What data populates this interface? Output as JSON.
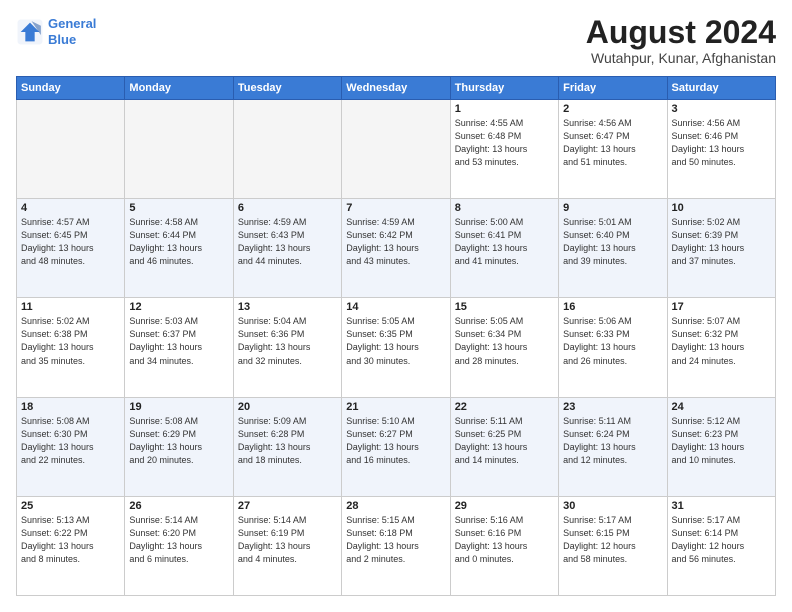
{
  "header": {
    "logo_line1": "General",
    "logo_line2": "Blue",
    "month_year": "August 2024",
    "location": "Wutahpur, Kunar, Afghanistan"
  },
  "weekdays": [
    "Sunday",
    "Monday",
    "Tuesday",
    "Wednesday",
    "Thursday",
    "Friday",
    "Saturday"
  ],
  "weeks": [
    [
      {
        "day": "",
        "info": ""
      },
      {
        "day": "",
        "info": ""
      },
      {
        "day": "",
        "info": ""
      },
      {
        "day": "",
        "info": ""
      },
      {
        "day": "1",
        "info": "Sunrise: 4:55 AM\nSunset: 6:48 PM\nDaylight: 13 hours\nand 53 minutes."
      },
      {
        "day": "2",
        "info": "Sunrise: 4:56 AM\nSunset: 6:47 PM\nDaylight: 13 hours\nand 51 minutes."
      },
      {
        "day": "3",
        "info": "Sunrise: 4:56 AM\nSunset: 6:46 PM\nDaylight: 13 hours\nand 50 minutes."
      }
    ],
    [
      {
        "day": "4",
        "info": "Sunrise: 4:57 AM\nSunset: 6:45 PM\nDaylight: 13 hours\nand 48 minutes."
      },
      {
        "day": "5",
        "info": "Sunrise: 4:58 AM\nSunset: 6:44 PM\nDaylight: 13 hours\nand 46 minutes."
      },
      {
        "day": "6",
        "info": "Sunrise: 4:59 AM\nSunset: 6:43 PM\nDaylight: 13 hours\nand 44 minutes."
      },
      {
        "day": "7",
        "info": "Sunrise: 4:59 AM\nSunset: 6:42 PM\nDaylight: 13 hours\nand 43 minutes."
      },
      {
        "day": "8",
        "info": "Sunrise: 5:00 AM\nSunset: 6:41 PM\nDaylight: 13 hours\nand 41 minutes."
      },
      {
        "day": "9",
        "info": "Sunrise: 5:01 AM\nSunset: 6:40 PM\nDaylight: 13 hours\nand 39 minutes."
      },
      {
        "day": "10",
        "info": "Sunrise: 5:02 AM\nSunset: 6:39 PM\nDaylight: 13 hours\nand 37 minutes."
      }
    ],
    [
      {
        "day": "11",
        "info": "Sunrise: 5:02 AM\nSunset: 6:38 PM\nDaylight: 13 hours\nand 35 minutes."
      },
      {
        "day": "12",
        "info": "Sunrise: 5:03 AM\nSunset: 6:37 PM\nDaylight: 13 hours\nand 34 minutes."
      },
      {
        "day": "13",
        "info": "Sunrise: 5:04 AM\nSunset: 6:36 PM\nDaylight: 13 hours\nand 32 minutes."
      },
      {
        "day": "14",
        "info": "Sunrise: 5:05 AM\nSunset: 6:35 PM\nDaylight: 13 hours\nand 30 minutes."
      },
      {
        "day": "15",
        "info": "Sunrise: 5:05 AM\nSunset: 6:34 PM\nDaylight: 13 hours\nand 28 minutes."
      },
      {
        "day": "16",
        "info": "Sunrise: 5:06 AM\nSunset: 6:33 PM\nDaylight: 13 hours\nand 26 minutes."
      },
      {
        "day": "17",
        "info": "Sunrise: 5:07 AM\nSunset: 6:32 PM\nDaylight: 13 hours\nand 24 minutes."
      }
    ],
    [
      {
        "day": "18",
        "info": "Sunrise: 5:08 AM\nSunset: 6:30 PM\nDaylight: 13 hours\nand 22 minutes."
      },
      {
        "day": "19",
        "info": "Sunrise: 5:08 AM\nSunset: 6:29 PM\nDaylight: 13 hours\nand 20 minutes."
      },
      {
        "day": "20",
        "info": "Sunrise: 5:09 AM\nSunset: 6:28 PM\nDaylight: 13 hours\nand 18 minutes."
      },
      {
        "day": "21",
        "info": "Sunrise: 5:10 AM\nSunset: 6:27 PM\nDaylight: 13 hours\nand 16 minutes."
      },
      {
        "day": "22",
        "info": "Sunrise: 5:11 AM\nSunset: 6:25 PM\nDaylight: 13 hours\nand 14 minutes."
      },
      {
        "day": "23",
        "info": "Sunrise: 5:11 AM\nSunset: 6:24 PM\nDaylight: 13 hours\nand 12 minutes."
      },
      {
        "day": "24",
        "info": "Sunrise: 5:12 AM\nSunset: 6:23 PM\nDaylight: 13 hours\nand 10 minutes."
      }
    ],
    [
      {
        "day": "25",
        "info": "Sunrise: 5:13 AM\nSunset: 6:22 PM\nDaylight: 13 hours\nand 8 minutes."
      },
      {
        "day": "26",
        "info": "Sunrise: 5:14 AM\nSunset: 6:20 PM\nDaylight: 13 hours\nand 6 minutes."
      },
      {
        "day": "27",
        "info": "Sunrise: 5:14 AM\nSunset: 6:19 PM\nDaylight: 13 hours\nand 4 minutes."
      },
      {
        "day": "28",
        "info": "Sunrise: 5:15 AM\nSunset: 6:18 PM\nDaylight: 13 hours\nand 2 minutes."
      },
      {
        "day": "29",
        "info": "Sunrise: 5:16 AM\nSunset: 6:16 PM\nDaylight: 13 hours\nand 0 minutes."
      },
      {
        "day": "30",
        "info": "Sunrise: 5:17 AM\nSunset: 6:15 PM\nDaylight: 12 hours\nand 58 minutes."
      },
      {
        "day": "31",
        "info": "Sunrise: 5:17 AM\nSunset: 6:14 PM\nDaylight: 12 hours\nand 56 minutes."
      }
    ]
  ]
}
